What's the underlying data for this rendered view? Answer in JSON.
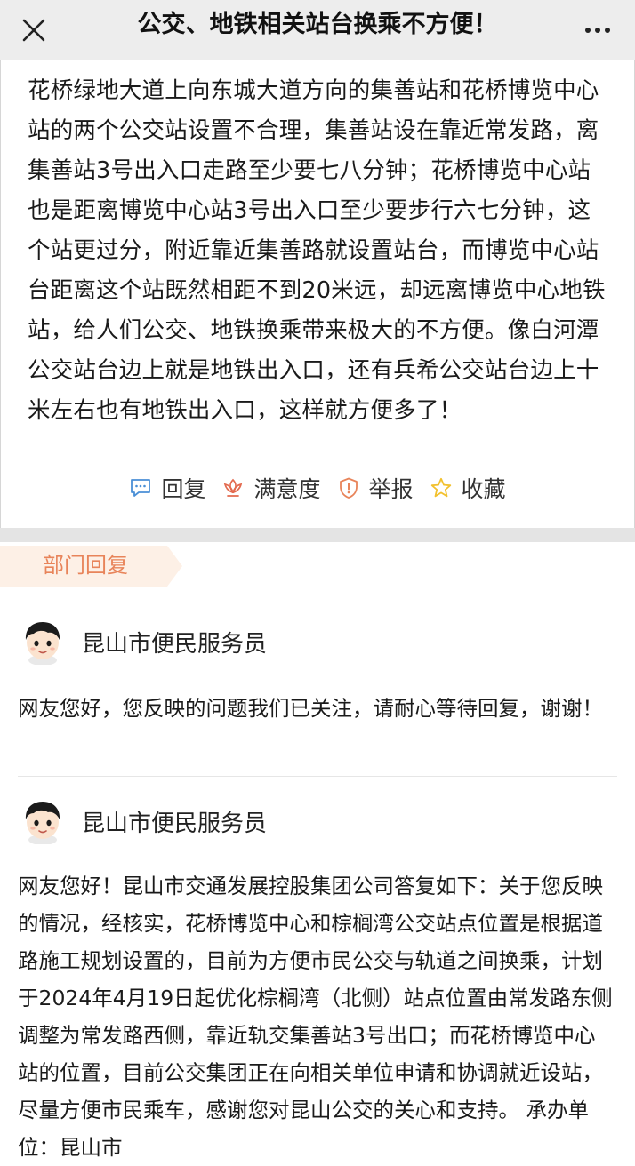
{
  "header": {
    "title": "公交、地铁相关站台换乘不方便！"
  },
  "post": {
    "content": "花桥绿地大道上向东城大道方向的集善站和花桥博览中心站的两个公交站设置不合理，集善站设在靠近常发路，离集善站3号出入口走路至少要七八分钟；花桥博览中心站也是距离博览中心站3号出入口至少要步行六七分钟，这个站更过分，附近靠近集善路就设置站台，而博览中心站台距离这个站既然相距不到20米远，却远离博览中心地铁站，给人们公交、地铁换乘带来极大的不方便。像白河潭公交站台边上就是地铁出入口，还有兵希公交站台边上十米左右也有地铁出入口，这样就方便多了！"
  },
  "actions": {
    "reply": {
      "label": "回复",
      "icon": "comment-icon",
      "color": "#4a8fd6"
    },
    "satisfaction": {
      "label": "满意度",
      "icon": "lotus-icon",
      "color": "#e36a4f"
    },
    "report": {
      "label": "举报",
      "icon": "shield-alert-icon",
      "color": "#e8845a"
    },
    "favorite": {
      "label": "收藏",
      "icon": "star-icon",
      "color": "#f2c12e"
    }
  },
  "section": {
    "label": "部门回复",
    "accent": "#e8845a"
  },
  "replies": [
    {
      "name": "昆山市便民服务员",
      "body": "网友您好，您反映的问题我们已关注，请耐心等待回复，谢谢！"
    },
    {
      "name": "昆山市便民服务员",
      "body": "网友您好！昆山市交通发展控股集团公司答复如下：关于您反映的情况，经核实，花桥博览中心和棕榈湾公交站点位置是根据道路施工规划设置的，目前为方便市民公交与轨道之间换乘，计划于2024年4月19日起优化棕榈湾（北侧）站点位置由常发路东侧调整为常发路西侧，靠近轨交集善站3号出口；而花桥博览中心站的位置，目前公交集团正在向相关单位申请和协调就近设站，尽量方便市民乘车，感谢您对昆山公交的关心和支持。 承办单位：昆山市"
    }
  ]
}
